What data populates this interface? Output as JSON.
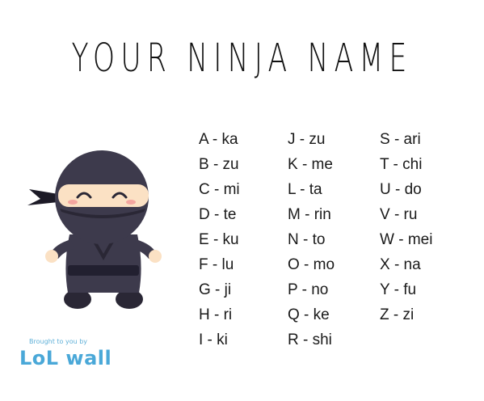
{
  "title": "YOUR NINJA NAME",
  "alphabet_columns": [
    [
      "A - ka",
      "B - zu",
      "C - mi",
      "D - te",
      "E - ku",
      "F - lu",
      "G - ji",
      "H - ri",
      "I - ki"
    ],
    [
      "J - zu",
      "K - me",
      "L - ta",
      "M - rin",
      "N - to",
      "O - mo",
      "P - no",
      "Q - ke",
      "R - shi"
    ],
    [
      "S - ari",
      "T - chi",
      "U - do",
      "V - ru",
      "W - mei",
      "X - na",
      "Y - fu",
      "Z - zi"
    ]
  ],
  "branding": {
    "tagline": "Brought to you by",
    "logo": "LoL wall"
  },
  "colors": {
    "ninja_suit": "#3d3a4c",
    "ninja_suit_dark": "#2a2735",
    "skin": "#fbe1c4",
    "blush": "#f4a6a0",
    "brand": "#4aa8d8"
  },
  "illustration": "ninja-mascot"
}
